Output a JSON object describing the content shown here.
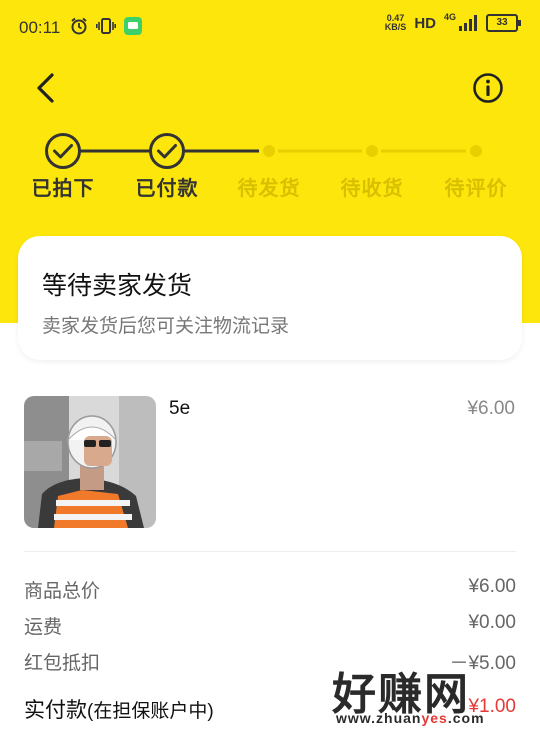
{
  "status_bar": {
    "time": "00:11",
    "speed_value": "0.47",
    "speed_unit": "KB/S",
    "hd": "HD",
    "network": "4G",
    "battery": "33"
  },
  "steps": [
    {
      "label": "已拍下",
      "done": true
    },
    {
      "label": "已付款",
      "done": true
    },
    {
      "label": "待发货",
      "done": false
    },
    {
      "label": "待收货",
      "done": false
    },
    {
      "label": "待评价",
      "done": false
    }
  ],
  "status_card": {
    "title": "等待卖家发货",
    "subtitle": "卖家发货后您可关注物流记录"
  },
  "product": {
    "name": "5e",
    "price": "¥6.00"
  },
  "summary": [
    {
      "label": "商品总价",
      "value": "¥6.00"
    },
    {
      "label": "运费",
      "value": "¥0.00"
    },
    {
      "label": "红包抵扣",
      "value": "－¥5.00"
    }
  ],
  "paid": {
    "label": "实付款",
    "note": "(在担保账户中)",
    "value": "¥1.00"
  },
  "watermark": {
    "big": "好赚网",
    "small_a": "www.zhuan",
    "small_b": "yes",
    "small_c": ".com"
  },
  "colors": {
    "brand_yellow": "#FDE60B",
    "step_active": "#333333",
    "step_inactive": "#E8CF00"
  }
}
